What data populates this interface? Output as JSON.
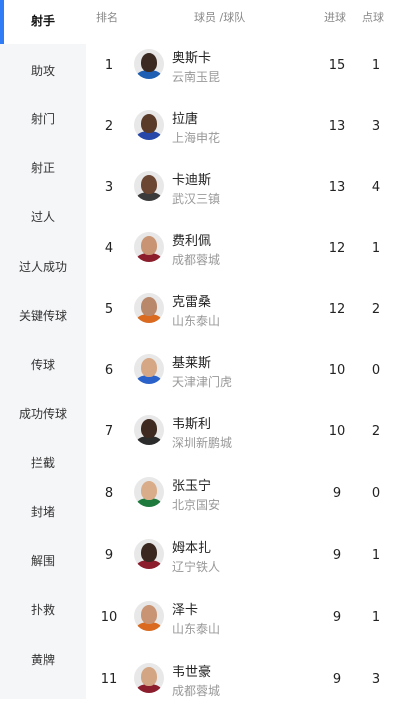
{
  "sidebar": {
    "items": [
      {
        "label": "射手"
      },
      {
        "label": "助攻"
      },
      {
        "label": "射门"
      },
      {
        "label": "射正"
      },
      {
        "label": "过人"
      },
      {
        "label": "过人成功"
      },
      {
        "label": "关键传球"
      },
      {
        "label": "传球"
      },
      {
        "label": "成功传球"
      },
      {
        "label": "拦截"
      },
      {
        "label": "封堵"
      },
      {
        "label": "解围"
      },
      {
        "label": "扑救"
      },
      {
        "label": "黄牌"
      }
    ]
  },
  "table": {
    "headers": {
      "rank": "排名",
      "player": "球员 /球队",
      "goals": "进球",
      "penalties": "点球"
    },
    "rows": [
      {
        "rank": "1",
        "name": "奥斯卡",
        "team": "云南玉昆",
        "goals": "15",
        "penalties": "1",
        "skin": "#3b2a22",
        "shirt": "#1e5fb3"
      },
      {
        "rank": "2",
        "name": "拉唐",
        "team": "上海申花",
        "goals": "13",
        "penalties": "3",
        "skin": "#5a3b2a",
        "shirt": "#2748a8"
      },
      {
        "rank": "3",
        "name": "卡迪斯",
        "team": "武汉三镇",
        "goals": "13",
        "penalties": "4",
        "skin": "#6b4632",
        "shirt": "#3b3b3b"
      },
      {
        "rank": "4",
        "name": "费利佩",
        "team": "成都蓉城",
        "goals": "12",
        "penalties": "1",
        "skin": "#c89474",
        "shirt": "#8b1d2c"
      },
      {
        "rank": "5",
        "name": "克雷桑",
        "team": "山东泰山",
        "goals": "12",
        "penalties": "2",
        "skin": "#b9876a",
        "shirt": "#d96a1f"
      },
      {
        "rank": "6",
        "name": "基莱斯",
        "team": "天津津门虎",
        "goals": "10",
        "penalties": "0",
        "skin": "#d6a784",
        "shirt": "#2a62c9"
      },
      {
        "rank": "7",
        "name": "韦斯利",
        "team": "深圳新鹏城",
        "goals": "10",
        "penalties": "2",
        "skin": "#3e2a20",
        "shirt": "#2c2c2c"
      },
      {
        "rank": "8",
        "name": "张玉宁",
        "team": "北京国安",
        "goals": "9",
        "penalties": "0",
        "skin": "#d9ad8a",
        "shirt": "#1f7a3d"
      },
      {
        "rank": "9",
        "name": "姆本扎",
        "team": "辽宁铁人",
        "goals": "9",
        "penalties": "1",
        "skin": "#3a2820",
        "shirt": "#8b1d2c"
      },
      {
        "rank": "10",
        "name": "泽卡",
        "team": "山东泰山",
        "goals": "9",
        "penalties": "1",
        "skin": "#c89474",
        "shirt": "#d96a1f"
      },
      {
        "rank": "11",
        "name": "韦世豪",
        "team": "成都蓉城",
        "goals": "9",
        "penalties": "3",
        "skin": "#d3a583",
        "shirt": "#8b1d2c"
      }
    ]
  },
  "colors": {
    "accent": "#2f7cf6",
    "sidebar_bg": "#f5f6f8",
    "muted_text": "#999999"
  }
}
